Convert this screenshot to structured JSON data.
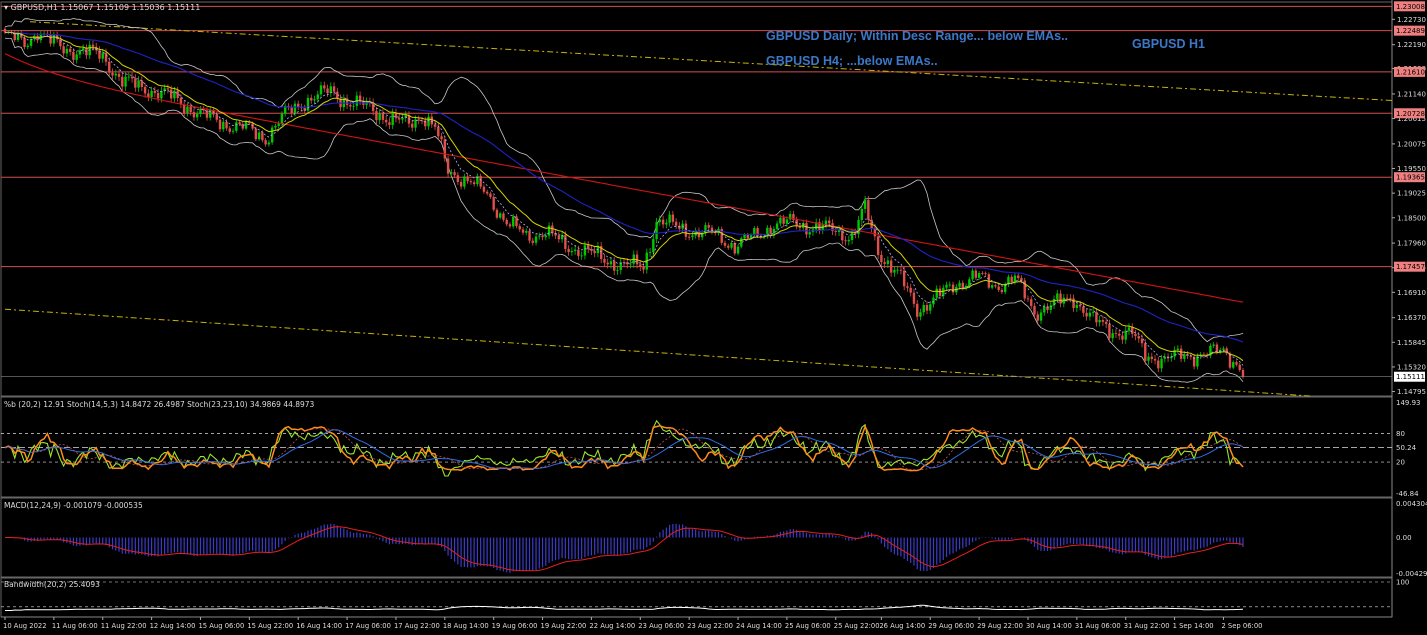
{
  "main": {
    "header": "GBPUSD,H1  1.15067 1.15109 1.15036 1.15111",
    "annotations": [
      "GBPUSD Daily; Within Desc Range... below EMAs..",
      "GBPUSD H1",
      "GBPUSD H4; ...below EMAs.."
    ]
  },
  "indicators": {
    "stoch_header": "%b (20,2) 12.91  Stoch(14,5,3) 14.8472 26.4987  Stoch(23,23,10) 34.9869 44.8973",
    "macd_header": "MACD(12,24,9) -0.001079 -0.000535",
    "bw_header": "Bandwidth(20,2) 25.4093"
  },
  "colors": {
    "bull": "#00c800",
    "bear": "#e0504a",
    "ema_short": "#d4d400",
    "ema_mid": "#1e22c8",
    "ema_long": "#d01414",
    "level_line": "#d25050",
    "trend_line": "#c8b400",
    "bands": "#c8c8c8",
    "annotation": "#3c78c8"
  },
  "chart_data": [
    {
      "type": "candlestick",
      "symbol": "GBPUSD",
      "timeframe": "H1",
      "ylim": [
        1.147,
        1.231
      ],
      "price_ticks": [
        "1.22730",
        "1.22190",
        "1.21680",
        "1.21140",
        "1.20615",
        "1.20075",
        "1.19550",
        "1.19025",
        "1.18500",
        "1.17960",
        "1.17435",
        "1.16910",
        "1.16370",
        "1.15845",
        "1.15320",
        "1.14795"
      ],
      "levels": [
        "1.23008",
        "1.22489",
        "1.21610",
        "1.20728",
        "1.19365",
        "1.17457"
      ],
      "last_price": "1.15111",
      "x_labels": [
        "10 Aug 2022",
        "11 Aug 06:00",
        "11 Aug 22:00",
        "12 Aug 14:00",
        "15 Aug 06:00",
        "15 Aug 22:00",
        "16 Aug 14:00",
        "17 Aug 06:00",
        "17 Aug 22:00",
        "18 Aug 14:00",
        "19 Aug 06:00",
        "19 Aug 22:00",
        "22 Aug 14:00",
        "23 Aug 06:00",
        "23 Aug 22:00",
        "24 Aug 14:00",
        "25 Aug 06:00",
        "25 Aug 22:00",
        "26 Aug 14:00",
        "29 Aug 06:00",
        "29 Aug 22:00",
        "30 Aug 14:00",
        "31 Aug 06:00",
        "31 Aug 22:00",
        "1 Sep 14:00",
        "2 Sep 06:00"
      ],
      "close_path": [
        {
          "i": 0,
          "v": 1.224
        },
        {
          "i": 6,
          "v": 1.222
        },
        {
          "i": 10,
          "v": 1.225
        },
        {
          "i": 14,
          "v": 1.2225
        },
        {
          "i": 18,
          "v": 1.221
        },
        {
          "i": 24,
          "v": 1.2205
        },
        {
          "i": 30,
          "v": 1.2195
        },
        {
          "i": 36,
          "v": 1.214
        },
        {
          "i": 44,
          "v": 1.2125
        },
        {
          "i": 52,
          "v": 1.2105
        },
        {
          "i": 60,
          "v": 1.207
        },
        {
          "i": 68,
          "v": 1.205
        },
        {
          "i": 74,
          "v": 1.204
        },
        {
          "i": 80,
          "v": 1.202
        },
        {
          "i": 86,
          "v": 1.207
        },
        {
          "i": 92,
          "v": 1.21
        },
        {
          "i": 100,
          "v": 1.212
        },
        {
          "i": 106,
          "v": 1.2095
        },
        {
          "i": 112,
          "v": 1.2085
        },
        {
          "i": 118,
          "v": 1.206
        },
        {
          "i": 124,
          "v": 1.205
        },
        {
          "i": 128,
          "v": 1.207
        },
        {
          "i": 132,
          "v": 1.204
        },
        {
          "i": 136,
          "v": 1.195
        },
        {
          "i": 142,
          "v": 1.193
        },
        {
          "i": 148,
          "v": 1.19
        },
        {
          "i": 154,
          "v": 1.184
        },
        {
          "i": 160,
          "v": 1.181
        },
        {
          "i": 166,
          "v": 1.182
        },
        {
          "i": 172,
          "v": 1.179
        },
        {
          "i": 178,
          "v": 1.178
        },
        {
          "i": 184,
          "v": 1.176
        },
        {
          "i": 190,
          "v": 1.175
        },
        {
          "i": 196,
          "v": 1.1745
        },
        {
          "i": 200,
          "v": 1.1845
        },
        {
          "i": 206,
          "v": 1.183
        },
        {
          "i": 212,
          "v": 1.182
        },
        {
          "i": 218,
          "v": 1.1815
        },
        {
          "i": 224,
          "v": 1.179
        },
        {
          "i": 230,
          "v": 1.181
        },
        {
          "i": 236,
          "v": 1.1835
        },
        {
          "i": 242,
          "v": 1.184
        },
        {
          "i": 248,
          "v": 1.183
        },
        {
          "i": 254,
          "v": 1.1825
        },
        {
          "i": 260,
          "v": 1.181
        },
        {
          "i": 264,
          "v": 1.187
        },
        {
          "i": 268,
          "v": 1.178
        },
        {
          "i": 274,
          "v": 1.173
        },
        {
          "i": 280,
          "v": 1.1655
        },
        {
          "i": 286,
          "v": 1.168
        },
        {
          "i": 292,
          "v": 1.171
        },
        {
          "i": 298,
          "v": 1.1725
        },
        {
          "i": 304,
          "v": 1.1705
        },
        {
          "i": 310,
          "v": 1.172
        },
        {
          "i": 316,
          "v": 1.165
        },
        {
          "i": 322,
          "v": 1.1665
        },
        {
          "i": 328,
          "v": 1.168
        },
        {
          "i": 334,
          "v": 1.163
        },
        {
          "i": 340,
          "v": 1.161
        },
        {
          "i": 346,
          "v": 1.16
        },
        {
          "i": 350,
          "v": 1.156
        },
        {
          "i": 356,
          "v": 1.1545
        },
        {
          "i": 362,
          "v": 1.156
        },
        {
          "i": 368,
          "v": 1.1555
        },
        {
          "i": 374,
          "v": 1.157
        },
        {
          "i": 378,
          "v": 1.154
        },
        {
          "i": 380,
          "v": 1.1511
        }
      ]
    },
    {
      "type": "line",
      "panel": "oscillator",
      "ylim": [
        -46.84,
        149.93
      ],
      "ticks": [
        "149.93",
        "80",
        "50.24",
        "20",
        "-46.84"
      ]
    },
    {
      "type": "bar",
      "panel": "macd",
      "ylim": [
        -0.004298,
        0.004304
      ],
      "ticks": [
        "0.004304",
        "0.00",
        "-0.004298"
      ]
    },
    {
      "type": "line",
      "panel": "bandwidth",
      "ticks": [
        "100"
      ]
    }
  ]
}
